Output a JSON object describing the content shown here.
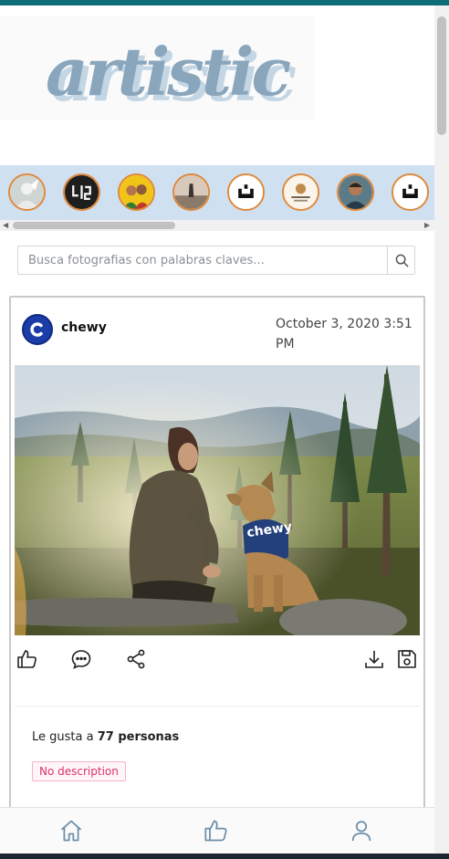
{
  "app": {
    "logo_text": "artistic"
  },
  "stories": {
    "items": [
      {
        "name": "story-1",
        "color": "#d8dcd8"
      },
      {
        "name": "story-2",
        "color": "#2b2b2b"
      },
      {
        "name": "story-3",
        "color": "#f1c40f"
      },
      {
        "name": "story-4",
        "color": "#c9b7a6"
      },
      {
        "name": "story-5",
        "color": "#ffffff"
      },
      {
        "name": "story-6",
        "color": "#f7efe3"
      },
      {
        "name": "story-7",
        "color": "#4f6d7a"
      },
      {
        "name": "story-8",
        "color": "#ffffff"
      }
    ]
  },
  "search": {
    "placeholder": "Busca fotografias con palabras claves..."
  },
  "post": {
    "author": "chewy",
    "date": "October 3, 2020 3:51 PM",
    "bandana_text": "chewy",
    "likes_prefix": "Le gusta a ",
    "likes_count": "77 personas",
    "description_badge": "No description"
  },
  "colors": {
    "accent_border": "#e0883a",
    "stories_bg": "#cfe0f0",
    "badge_text": "#d6336c"
  }
}
